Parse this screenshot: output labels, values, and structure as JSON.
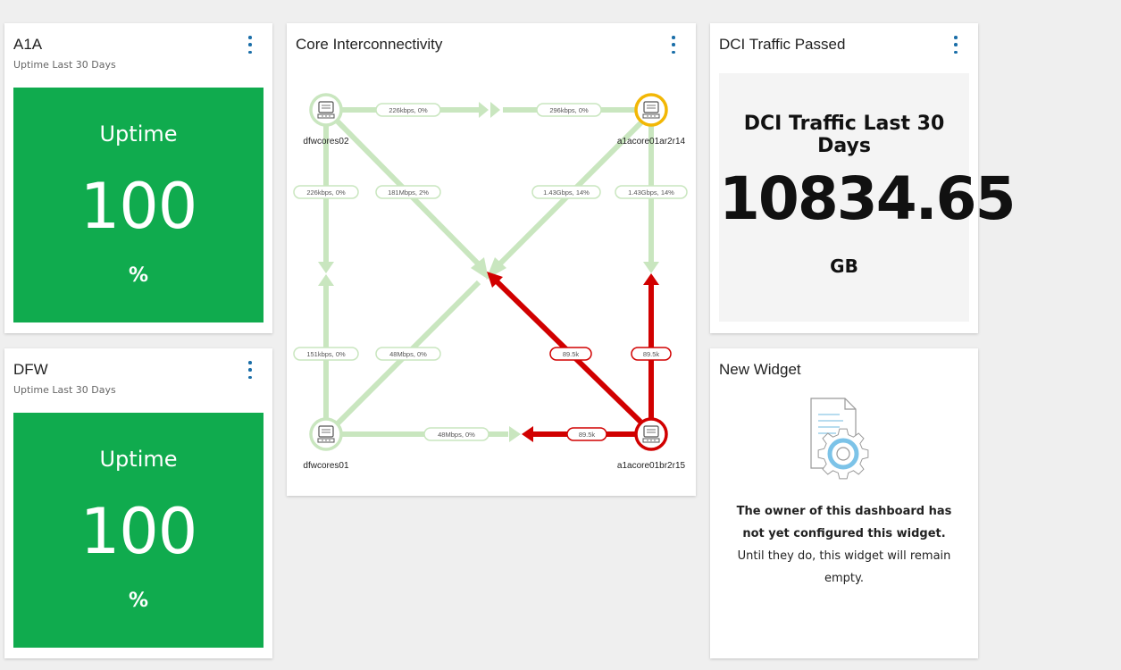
{
  "widgets": {
    "a1a": {
      "title": "A1A",
      "subtitle": "Uptime Last 30 Days",
      "uptime_label": "Uptime",
      "value": "100",
      "unit": "%",
      "color": "#10ab4e"
    },
    "dfw": {
      "title": "DFW",
      "subtitle": "Uptime Last 30 Days",
      "uptime_label": "Uptime",
      "value": "100",
      "unit": "%",
      "color": "#10ab4e"
    },
    "core": {
      "title": "Core Interconnectivity",
      "nodes": {
        "dfwcores02": {
          "label": "dfwcores02",
          "status": "normal"
        },
        "a1acore01ar2r14": {
          "label": "a1acore01ar2r14",
          "status": "warning"
        },
        "dfwcores01": {
          "label": "dfwcores01",
          "status": "normal"
        },
        "a1acore01br2r15": {
          "label": "a1acore01br2r15",
          "status": "critical"
        }
      },
      "links": {
        "top_left": "226kbps, 0%",
        "top_right": "296kbps, 0%",
        "left_upper": "226kbps, 0%",
        "diag_a_upper": "181Mbps, 2%",
        "diag_b_upper": "1.43Gbps, 14%",
        "right_upper": "1.43Gbps, 14%",
        "left_lower": "151kbps, 0%",
        "diag_b_lower": "48Mbps, 0%",
        "diag_a_lower": "89.5k",
        "right_lower": "89.5k",
        "bottom_left": "48Mbps, 0%",
        "bottom_right": "89.5k"
      },
      "colors": {
        "ok": "#c9e6bf",
        "bad": "#d10000",
        "warning": "#f2b705",
        "node_ok": "#c9e6bf"
      }
    },
    "dci": {
      "title": "DCI Traffic Passed",
      "heading": "DCI Traffic Last 30 Days",
      "value": "10834.65",
      "unit": "GB"
    },
    "new": {
      "title": "New Widget",
      "message_bold_1": "The owner of this dashboard has",
      "message_bold_2": "not yet configured this widget.",
      "message_1": "Until they do, this widget will remain",
      "message_2": "empty.",
      "icon": "document-gear-icon"
    }
  }
}
